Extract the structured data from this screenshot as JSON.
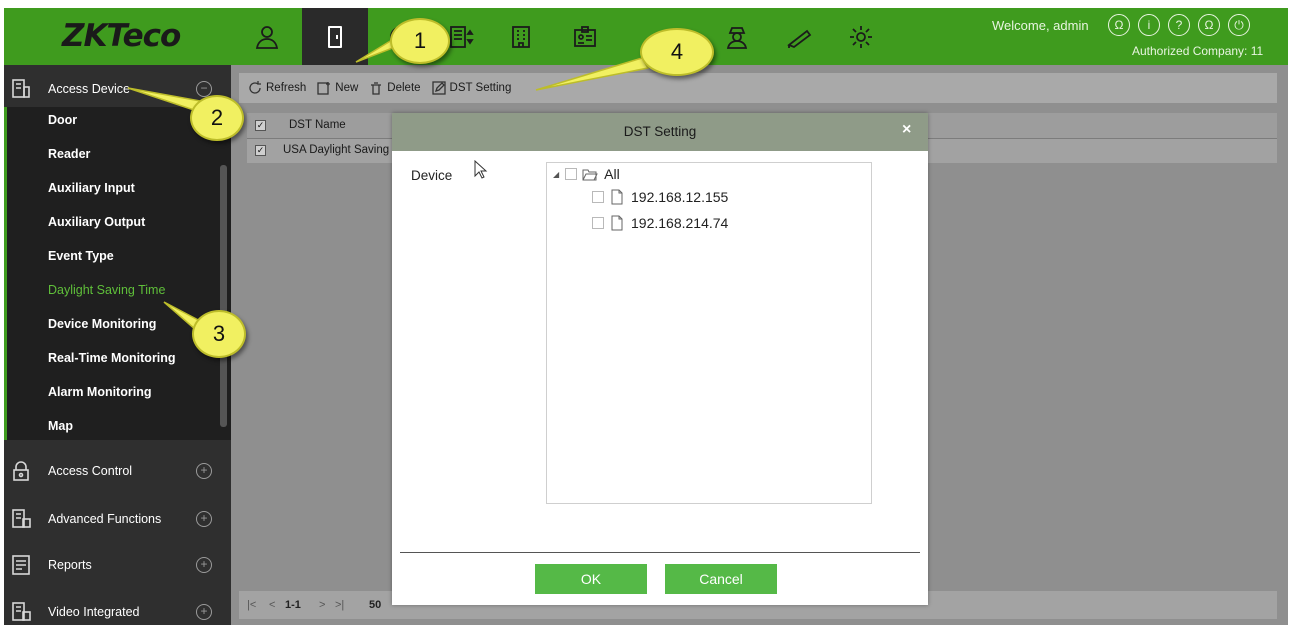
{
  "header": {
    "logo": "ZKTeco",
    "welcome": "Welcome, admin",
    "company": "Authorized Company: 11",
    "modules": [
      "person-icon",
      "door-icon",
      "attendance-icon",
      "elevator-icon",
      "building-icon",
      "badge-icon",
      "visitor-icon",
      "parking-icon",
      "settings-icon"
    ],
    "top_icons": [
      "user-icon",
      "info-icon",
      "help-icon",
      "account-icon",
      "power-icon"
    ],
    "accent_color": "#3f9b1e"
  },
  "sidebar": {
    "access_device": {
      "label": "Access Device",
      "items": [
        {
          "label": "Door"
        },
        {
          "label": "Reader"
        },
        {
          "label": "Auxiliary Input"
        },
        {
          "label": "Auxiliary Output"
        },
        {
          "label": "Event Type"
        },
        {
          "label": "Daylight Saving Time"
        },
        {
          "label": "Device Monitoring"
        },
        {
          "label": "Real-Time Monitoring"
        },
        {
          "label": "Alarm Monitoring"
        },
        {
          "label": "Map"
        }
      ],
      "active_item": "Daylight Saving Time"
    },
    "groups": [
      {
        "label": "Access Control"
      },
      {
        "label": "Advanced Functions"
      },
      {
        "label": "Reports"
      },
      {
        "label": "Video Integrated"
      }
    ]
  },
  "toolbar": {
    "refresh": "Refresh",
    "new": "New",
    "delete": "Delete",
    "dst_setting": "DST Setting"
  },
  "table": {
    "columns": [
      "DST Name"
    ],
    "rows": [
      {
        "name": "USA Daylight Saving"
      }
    ]
  },
  "pager": {
    "range": "1-1",
    "per_page": "50"
  },
  "dialog": {
    "title": "DST Setting",
    "close": "×",
    "field_label": "Device",
    "tree": {
      "root": "All",
      "children": [
        "192.168.12.155",
        "192.168.214.74"
      ]
    },
    "ok": "OK",
    "cancel": "Cancel"
  },
  "callouts": [
    "1",
    "2",
    "3",
    "4"
  ]
}
